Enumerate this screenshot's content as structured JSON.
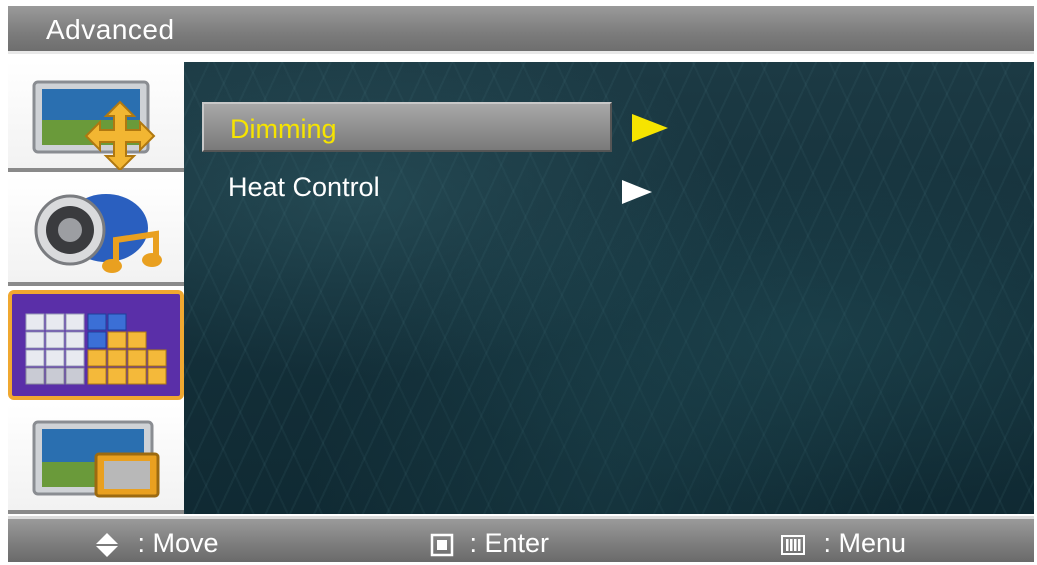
{
  "header": {
    "title": "Advanced"
  },
  "sidebar": {
    "items": [
      {
        "icon": "picture-size-icon",
        "selected": false
      },
      {
        "icon": "sound-icon",
        "selected": false
      },
      {
        "icon": "advanced-setup-icon",
        "selected": true
      },
      {
        "icon": "pip-icon",
        "selected": false
      }
    ]
  },
  "menu": {
    "items": [
      {
        "label": "Dimming",
        "highlighted": true,
        "arrow": "►"
      },
      {
        "label": "Heat Control",
        "highlighted": false,
        "arrow": "►"
      }
    ]
  },
  "footer": {
    "move": {
      "icon": "updown-icon",
      "label": ": Move"
    },
    "enter": {
      "icon": "enter-icon",
      "label": ": Enter"
    },
    "menu": {
      "icon": "menu-icon",
      "label": ": Menu"
    }
  },
  "colors": {
    "highlight_text": "#f6e400",
    "selected_sidebar_bg": "#5a2fa8",
    "selected_sidebar_border": "#f0a830",
    "bar_gray": "#8a8a8a",
    "background_teal": "#14303a"
  }
}
